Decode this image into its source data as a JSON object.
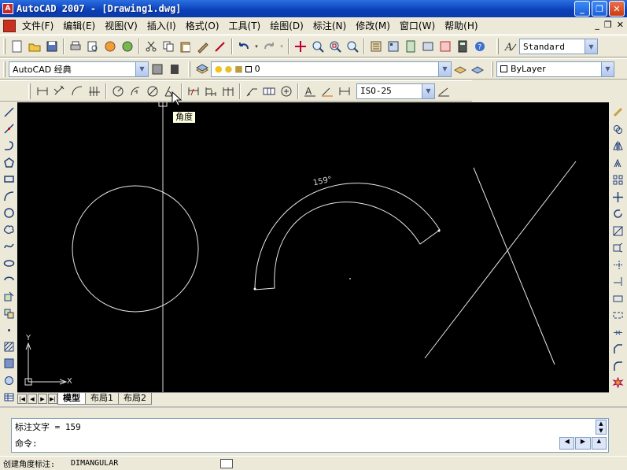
{
  "window": {
    "title": "AutoCAD 2007 - [Drawing1.dwg]",
    "app_icon": "A"
  },
  "menubar": {
    "items": [
      "文件(F)",
      "编辑(E)",
      "视图(V)",
      "插入(I)",
      "格式(O)",
      "工具(T)",
      "绘图(D)",
      "标注(N)",
      "修改(M)",
      "窗口(W)",
      "帮助(H)"
    ]
  },
  "toolbar": {
    "text_style": "Standard",
    "workspace": "AutoCAD 经典",
    "layer": "0",
    "color": "ByLayer",
    "dim_style": "ISO-25"
  },
  "tooltip": {
    "text": "角度"
  },
  "canvas": {
    "dimension_text": "159°",
    "ucs_x": "X",
    "ucs_y": "Y",
    "background": "#000000",
    "stroke": "#e6e6e6"
  },
  "layout_tabs": [
    "模型",
    "布局1",
    "布局2"
  ],
  "command": {
    "history_line": "标注文字 = 159",
    "prompt": "命令:"
  },
  "status": {
    "label": "创建角度标注:",
    "command": "DIMANGULAR"
  }
}
